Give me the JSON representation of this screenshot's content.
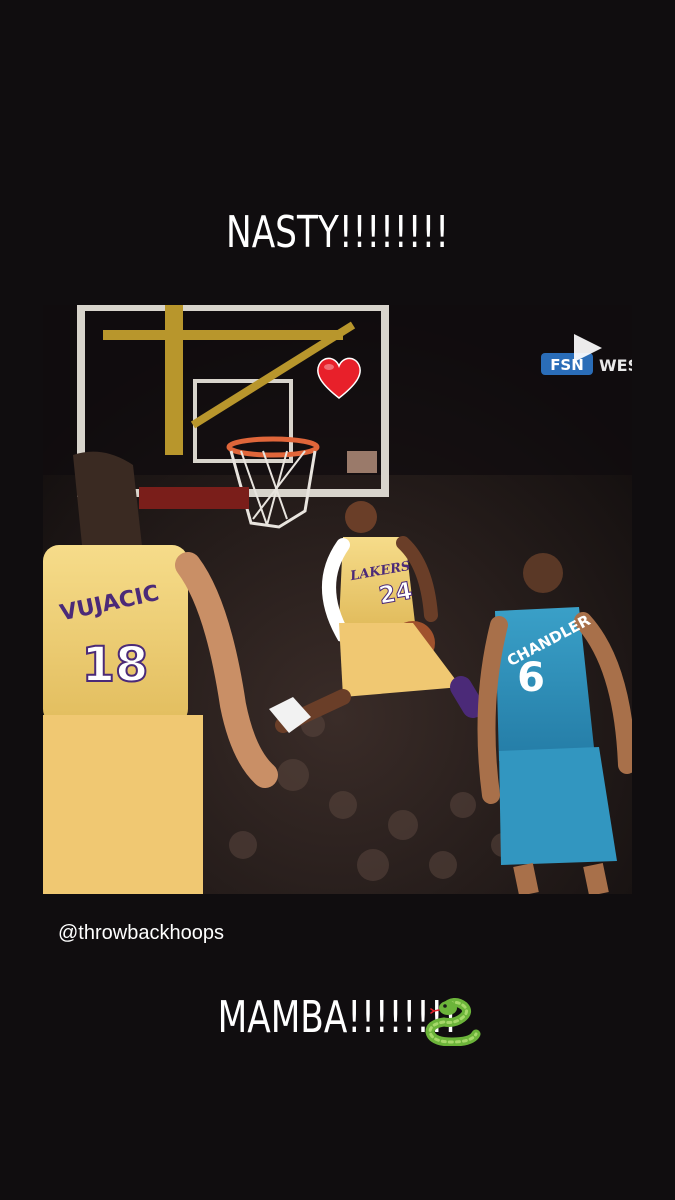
{
  "story": {
    "caption_top": "NASTY!!!!!!!!",
    "caption_bottom": "MAMBA!!!!!!!!",
    "credit": "@throwbackhoops"
  },
  "media": {
    "broadcast_logo": "FSN",
    "broadcast_text": "WES",
    "players": [
      {
        "name": "VUJACIC",
        "number": "18"
      },
      {
        "name": "",
        "number": "24",
        "team": "LAKERS"
      },
      {
        "name": "CHANDLER",
        "number": "6"
      }
    ]
  },
  "icons": {
    "play": "play-icon",
    "heart": "heart-icon",
    "snake": "snake-icon"
  },
  "colors": {
    "background": "#100d0f",
    "lakers_gold": "#f2d27a",
    "hornets_teal": "#2f8fb8",
    "lakers_purple": "#4b2a78"
  }
}
